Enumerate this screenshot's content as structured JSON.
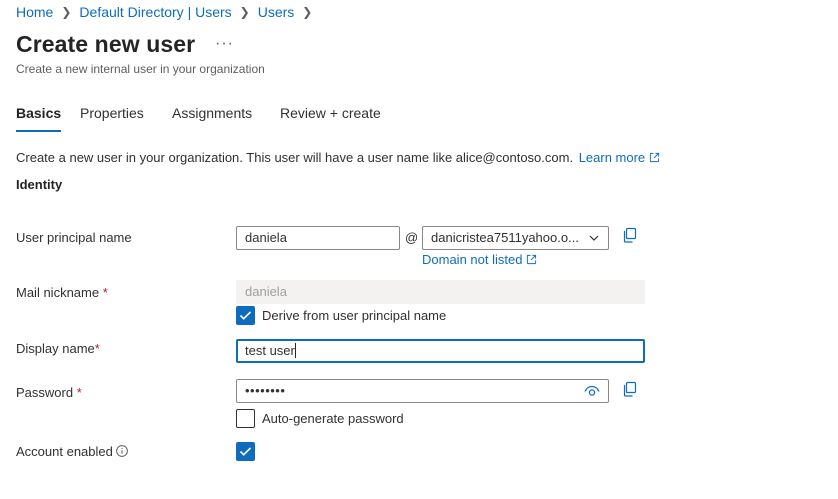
{
  "breadcrumb": {
    "items": [
      "Home",
      "Default Directory | Users",
      "Users"
    ]
  },
  "header": {
    "title": "Create new user",
    "more_label": "···",
    "subtitle": "Create a new internal user in your organization"
  },
  "tabs": [
    {
      "label": "Basics",
      "active": true
    },
    {
      "label": "Properties",
      "active": false
    },
    {
      "label": "Assignments",
      "active": false
    },
    {
      "label": "Review + create",
      "active": false
    }
  ],
  "intro": {
    "text": "Create a new user in your organization. This user will have a user name like alice@contoso.com.",
    "learn_more": "Learn more"
  },
  "section_title": "Identity",
  "form": {
    "upn": {
      "label": "User principal name",
      "value": "daniela",
      "at": "@",
      "domain": "danicristea7511yahoo.o...",
      "domain_not_listed": "Domain not listed"
    },
    "mail_nickname": {
      "label": "Mail nickname",
      "required_mark": "*",
      "value": "daniela",
      "derive_label": "Derive from user principal name",
      "derive_checked": true
    },
    "display_name": {
      "label": "Display name",
      "required_mark": "*",
      "value": "test user"
    },
    "password": {
      "label": "Password",
      "required_mark": "*",
      "value": "••••••••",
      "auto_generate_label": "Auto-generate password",
      "auto_generate_checked": false
    },
    "account_enabled": {
      "label": "Account enabled",
      "checked": true
    }
  },
  "colors": {
    "accent": "#0f6cbd",
    "required": "#a4262c",
    "text": "#323130",
    "muted": "#605e5c"
  }
}
